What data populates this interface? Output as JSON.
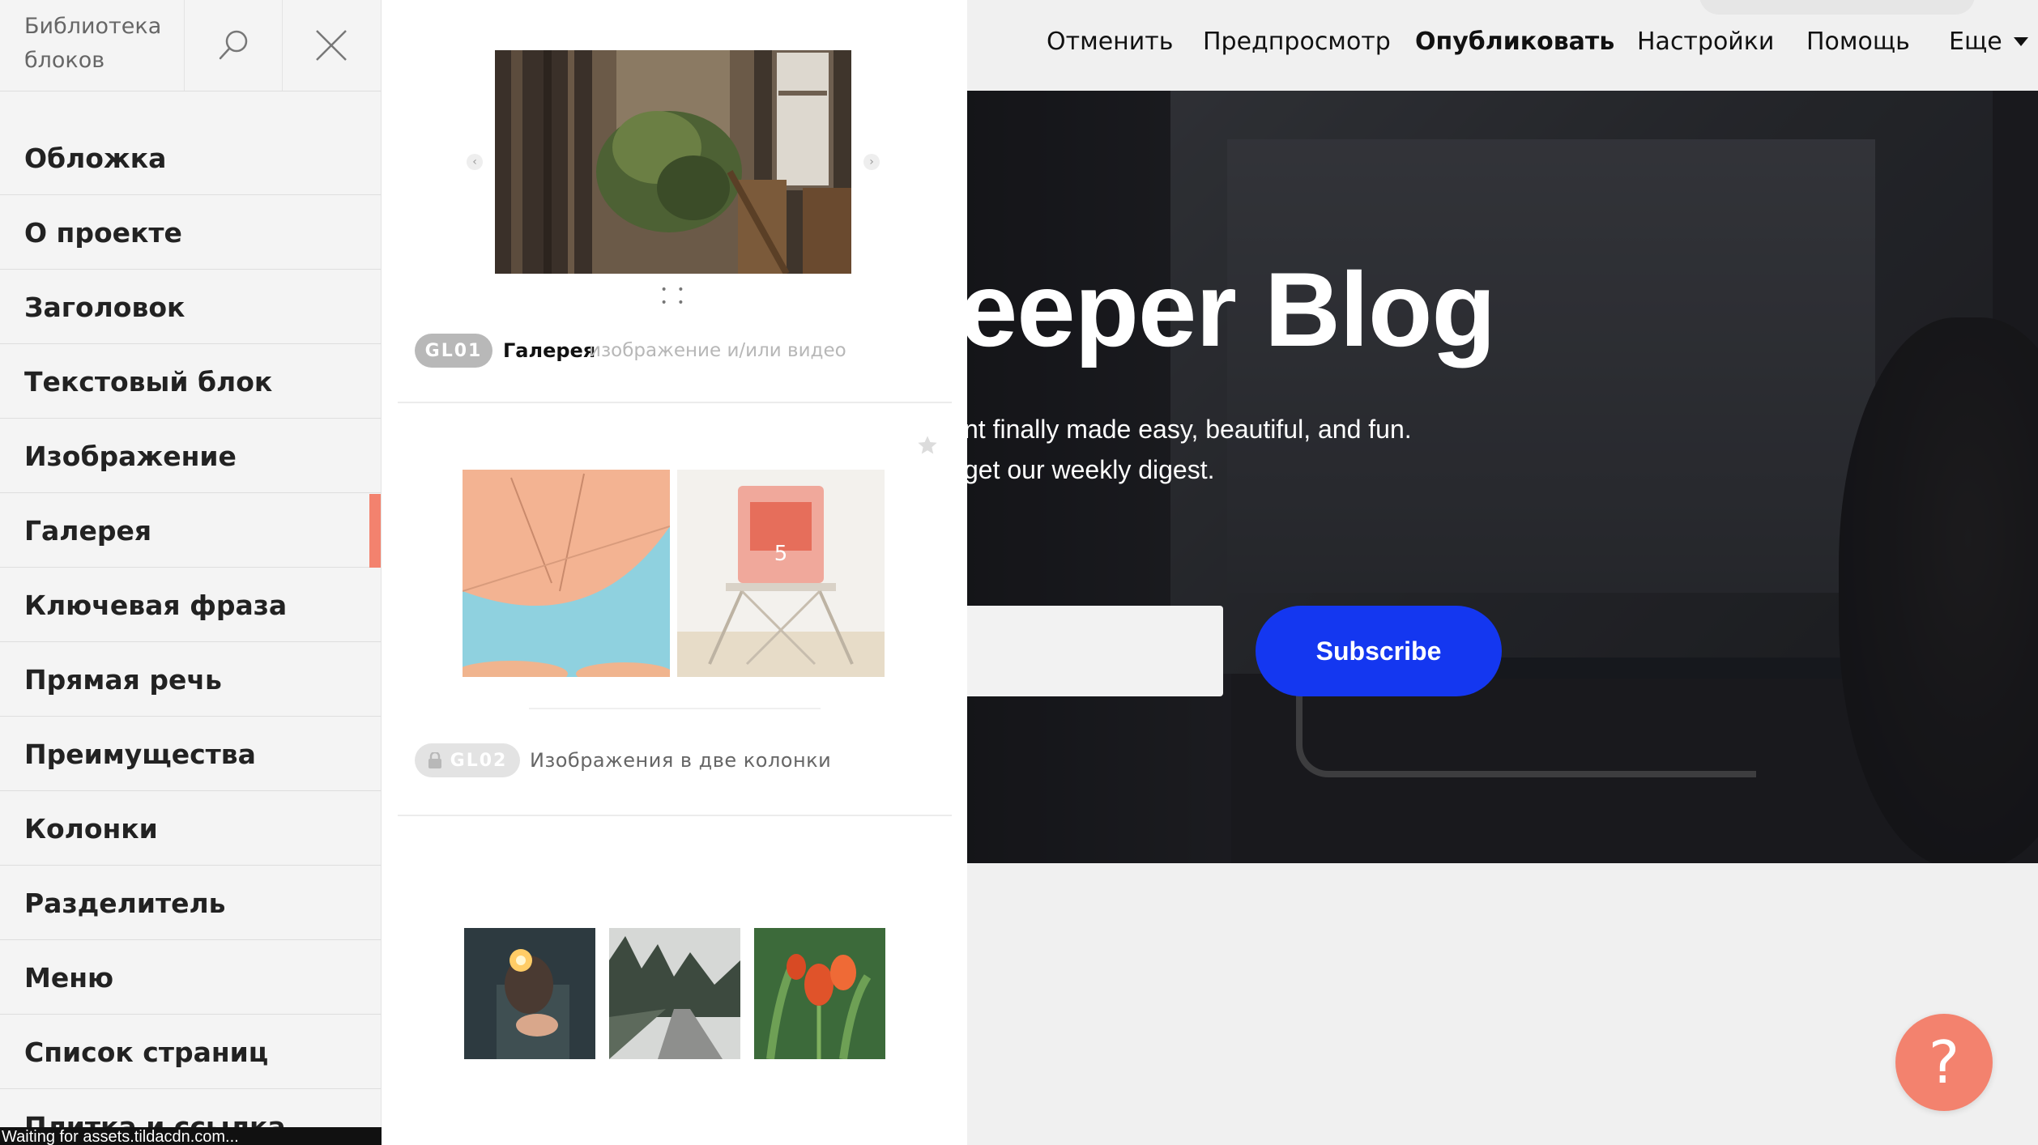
{
  "topbar": {
    "cancel": "Отменить",
    "preview": "Предпросмотр",
    "publish": "Опубликовать",
    "settings": "Настройки",
    "help": "Помощь",
    "more": "Еще"
  },
  "hero": {
    "title": "eeper Blog",
    "line1": "nt finally made easy, beautiful, and fun.",
    "line2": "get our weekly digest.",
    "subscribe": "Subscribe"
  },
  "help_button": "?",
  "sidebar": {
    "title": "Библиотека блоков",
    "categories": [
      {
        "label": "Обложка"
      },
      {
        "label": "О проекте"
      },
      {
        "label": "Заголовок"
      },
      {
        "label": "Текстовый блок"
      },
      {
        "label": "Изображение"
      },
      {
        "label": "Галерея",
        "active": true
      },
      {
        "label": "Ключевая фраза"
      },
      {
        "label": "Прямая речь"
      },
      {
        "label": "Преимущества"
      },
      {
        "label": "Колонки"
      },
      {
        "label": "Разделитель"
      },
      {
        "label": "Меню"
      },
      {
        "label": "Список страниц"
      },
      {
        "label": "Плитка и ссылка"
      }
    ]
  },
  "templates": [
    {
      "code": "GL01",
      "name": "Галерея",
      "desc": "изображение и/или видео"
    },
    {
      "code": "GL02",
      "name": "Изображения в две колонки",
      "locked": true
    }
  ],
  "status": "Waiting for assets.tildacdn.com...",
  "colors": {
    "accent": "#f3826e",
    "subscribe": "#1437f0"
  }
}
